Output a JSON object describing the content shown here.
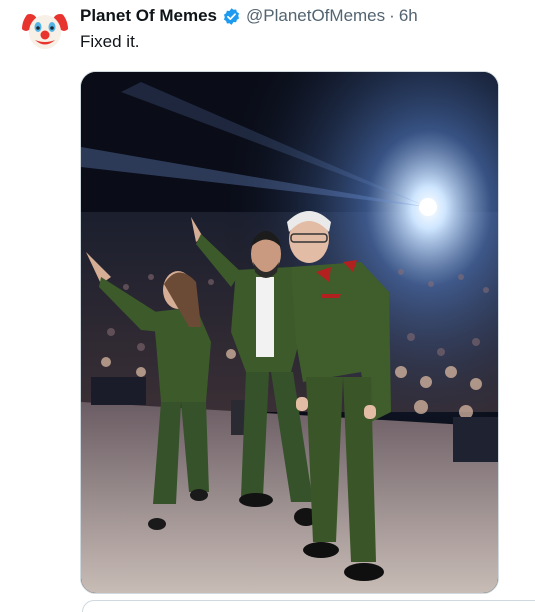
{
  "tweet": {
    "author": {
      "display_name": "Planet Of Memes",
      "handle": "@PlanetOfMemes",
      "verified": true,
      "avatar_icon": "clown-face-icon"
    },
    "separator": "·",
    "time": "6h",
    "text": "Fixed it.",
    "media": {
      "alt": "Three people in green military-style uniforms waving on a concert stage in front of a crowd"
    }
  },
  "colors": {
    "verified_blue": "#1d9bf0",
    "secondary_text": "#536471",
    "border": "#cfd9de",
    "uniform_green": "#3c5a2a"
  }
}
